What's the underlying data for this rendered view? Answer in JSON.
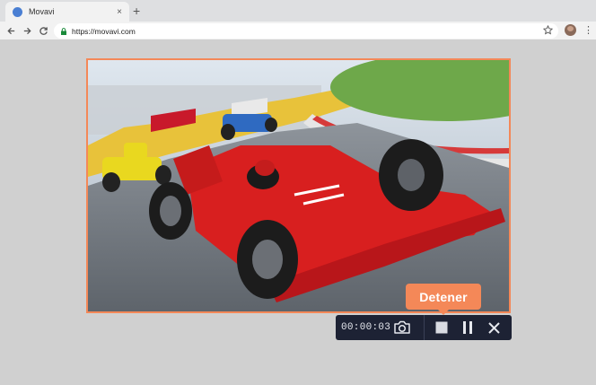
{
  "browser": {
    "tab_title": "Movavi",
    "tab_close": "×",
    "new_tab": "+",
    "url": "https://movavi.com"
  },
  "recorder": {
    "tooltip": "Detener",
    "timer": "00:00:03"
  },
  "icons": {
    "back": "back-arrow-icon",
    "forward": "forward-arrow-icon",
    "reload": "reload-icon",
    "lock": "lock-icon",
    "star": "star-icon",
    "camera": "camera-icon",
    "stop": "stop-icon",
    "pause": "pause-icon",
    "close": "close-icon"
  },
  "colors": {
    "accent": "#f48858",
    "bar": "#1d2234",
    "background": "#d0d0d0"
  }
}
